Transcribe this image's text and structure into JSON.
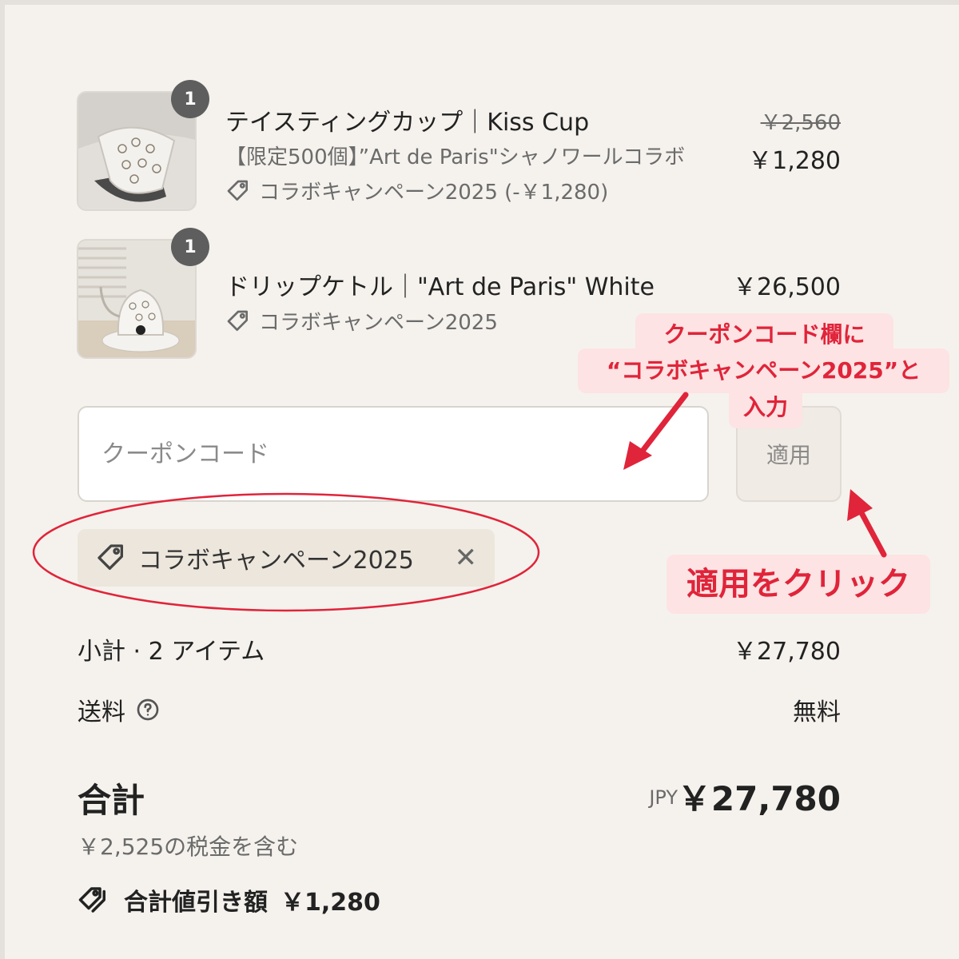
{
  "items": [
    {
      "quantity": "1",
      "title": "テイスティングカップ｜Kiss Cup",
      "variant": "【限定500個】”Art de Paris\"シャノワールコラボ",
      "discount": "コラボキャンペーン2025 (-￥1,280)",
      "price_original": "￥2,560",
      "price": "￥1,280"
    },
    {
      "quantity": "1",
      "title": "ドリップケトル｜\"Art de Paris\" White",
      "discount": "コラボキャンペーン2025",
      "price": "￥26,500"
    }
  ],
  "coupon": {
    "placeholder": "クーポンコード",
    "apply_label": "適用",
    "applied_code": "コラボキャンペーン2025",
    "remove_symbol": "✕"
  },
  "summary": {
    "subtotal_label": "小計 · 2 アイテム",
    "subtotal_value": "￥27,780",
    "shipping_label": "送料",
    "shipping_value": "無料",
    "total_label": "合計",
    "currency": "JPY",
    "total_value": "￥27,780",
    "tax_note": "￥2,525の税金を含む",
    "savings_label": "合計値引き額",
    "savings_value": "￥1,280"
  },
  "annotations": {
    "input_instruction": [
      "クーポンコード欄に",
      "“コラボキャンペーン2025”と",
      "入力"
    ],
    "apply_instruction": "適用をクリック",
    "accent_color": "#e0243a",
    "callout_bg": "#fde3e3"
  },
  "icons": [
    "tag-icon",
    "help-circle-icon",
    "close-icon",
    "tags-icon",
    "arrow-icon"
  ]
}
